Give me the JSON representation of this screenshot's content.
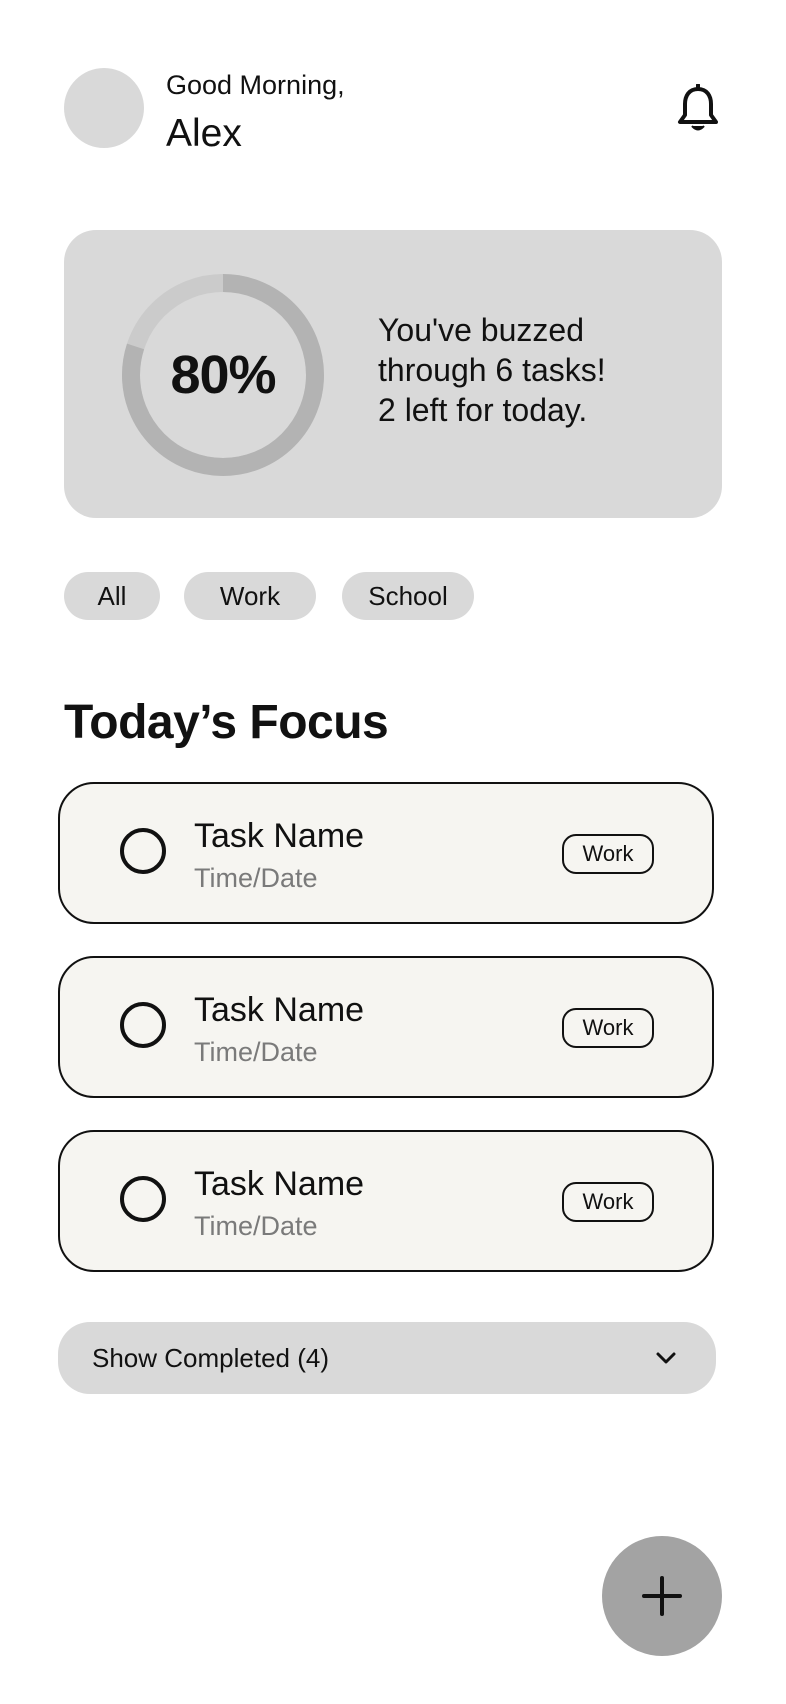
{
  "header": {
    "greeting": "Good Morning,",
    "username": "Alex",
    "avatar_icon": "avatar-placeholder",
    "notification_icon": "bell-icon"
  },
  "progress": {
    "percent": 80,
    "percent_label": "80%",
    "message_line1": "You've buzzed",
    "message_line2": "through 6 tasks!",
    "message_line3": "2 left for today."
  },
  "filters": {
    "all": "All",
    "work": "Work",
    "school": "School"
  },
  "section": {
    "title": "Today’s Focus"
  },
  "tasks": [
    {
      "name": "Task Name",
      "time": "Time/Date",
      "tag": "Work"
    },
    {
      "name": "Task Name",
      "time": "Time/Date",
      "tag": "Work"
    },
    {
      "name": "Task Name",
      "time": "Time/Date",
      "tag": "Work"
    }
  ],
  "completed": {
    "label": "Show Completed (4)",
    "icon": "chevron-down-icon"
  },
  "fab": {
    "icon": "plus-icon"
  },
  "colors": {
    "card_gray": "#d9d9d9",
    "ring_track": "#cbcbcb",
    "ring_fill": "#b3b3b3",
    "task_bg": "#f6f5f1",
    "muted_text": "#7a7a7a",
    "fab_bg": "#a3a3a3"
  }
}
